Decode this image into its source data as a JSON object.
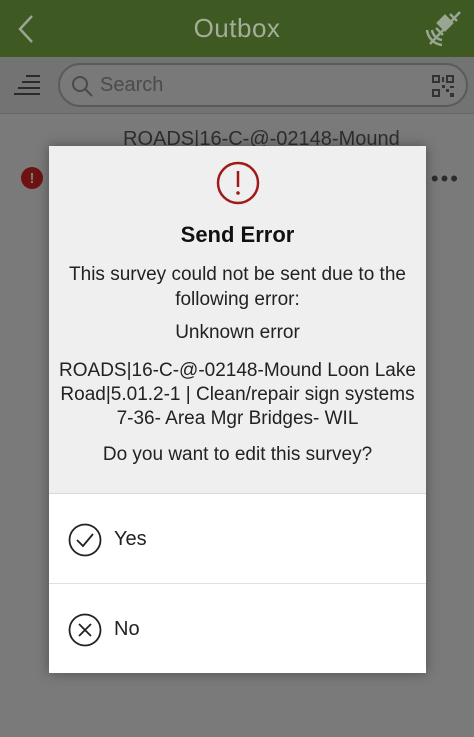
{
  "header": {
    "title": "Outbox"
  },
  "search": {
    "placeholder": "Search"
  },
  "list": {
    "items": [
      {
        "title": "ROADS|16-C-@-02148-Mound",
        "status": "!"
      }
    ]
  },
  "dialog": {
    "title": "Send Error",
    "message": "This survey could not be sent due to the following error:",
    "error": "Unknown error",
    "detail": "ROADS|16-C-@-02148-Mound Loon Lake Road|5.01.2-1 | Clean/repair sign systems 7-36- Area Mgr Bridges- WIL",
    "question": "Do you want to edit this survey?",
    "options": [
      {
        "label": "Yes",
        "icon": "check-circle-icon"
      },
      {
        "label": "No",
        "icon": "x-circle-icon"
      }
    ]
  },
  "colors": {
    "header_bg": "#3e5a22",
    "alert_red": "#a01a1a",
    "error_dot": "#6e1212"
  }
}
